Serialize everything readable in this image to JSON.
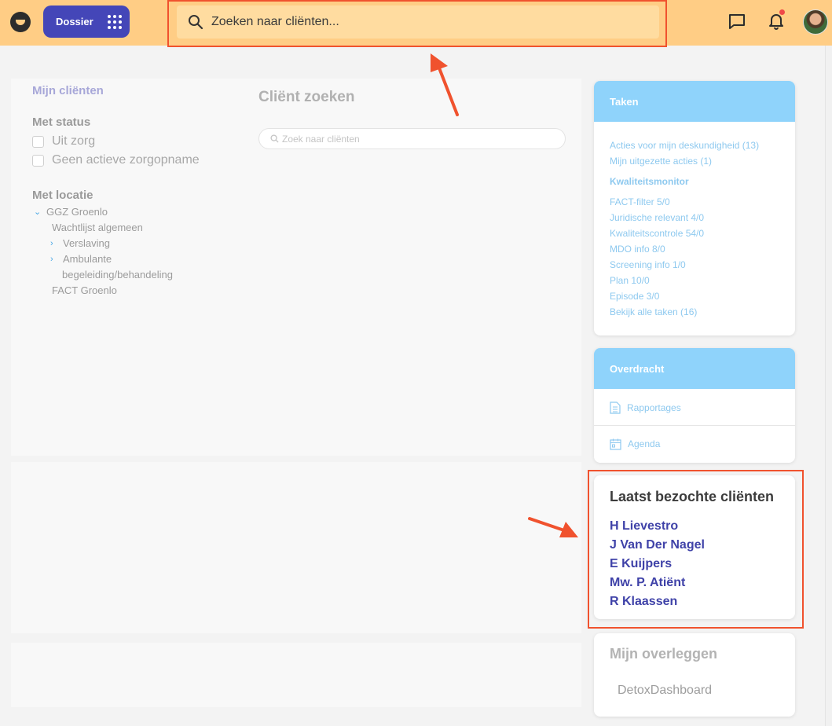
{
  "header": {
    "app_button_label": "Dossier",
    "search_placeholder": "Zoeken naar cliënten..."
  },
  "filters": {
    "my_clients": "Mijn cliënten",
    "status_heading": "Met status",
    "status_options": [
      "Uit zorg",
      "Geen actieve zorgopname"
    ],
    "location_heading": "Met locatie",
    "locations": [
      "GGZ Groenlo",
      "Wachtlijst algemeen",
      "Verslaving",
      "Ambulante",
      "begeleiding/behandeling",
      "FACT Groenlo"
    ]
  },
  "client_search": {
    "title": "Cliënt zoeken",
    "placeholder": "Zoek naar cliënten"
  },
  "tasks": {
    "title": "Taken",
    "links": [
      "Acties voor mijn deskundigheid (13)",
      "Mijn uitgezette acties (1)"
    ],
    "quality_heading": "Kwaliteitsmonitor",
    "quality_links": [
      "FACT-filter 5/0",
      "Juridische relevant 4/0",
      "Kwaliteitscontrole 54/0",
      "MDO info 8/0",
      "Screening info 1/0",
      "Plan 10/0",
      "Episode 3/0",
      "Bekijk alle taken (16)"
    ]
  },
  "handover": {
    "title": "Overdracht",
    "items": [
      "Rapportages",
      "Agenda"
    ]
  },
  "recent_clients": {
    "title": "Laatst bezochte cliënten",
    "clients": [
      "H Lievestro",
      "J Van Der Nagel",
      "E Kuijpers",
      "Mw. P. Atiënt",
      "R Klaassen"
    ]
  },
  "meetings": {
    "title": "Mijn overleggen",
    "items": [
      "DetoxDashboard"
    ]
  }
}
